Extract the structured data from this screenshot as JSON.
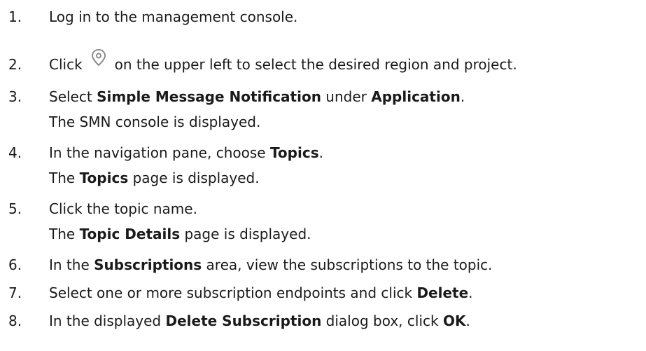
{
  "steps": [
    {
      "num": "1.",
      "parts": [
        "Log in to the management console."
      ]
    },
    {
      "num": "2.",
      "before": "Click",
      "after": "on the upper left to select the desired region and project."
    },
    {
      "num": "3.",
      "parts": [
        "Select ",
        "Simple Message Notification",
        " under ",
        "Application",
        "."
      ],
      "sub": "The SMN console is displayed."
    },
    {
      "num": "4.",
      "parts": [
        "In the navigation pane, choose ",
        "Topics",
        "."
      ],
      "sub_parts": [
        "The ",
        "Topics",
        " page is displayed."
      ]
    },
    {
      "num": "5.",
      "parts": [
        "Click the topic name."
      ],
      "sub_parts": [
        "The ",
        "Topic Details",
        " page is displayed."
      ]
    },
    {
      "num": "6.",
      "parts": [
        "In the ",
        "Subscriptions",
        " area, view the subscriptions to the topic."
      ]
    },
    {
      "num": "7.",
      "parts": [
        "Select one or more subscription endpoints and click ",
        "Delete",
        "."
      ]
    },
    {
      "num": "8.",
      "parts": [
        "In the displayed ",
        "Delete Subscription",
        " dialog box, click ",
        "OK",
        "."
      ]
    }
  ],
  "icons": {
    "region": "location-pin-icon"
  }
}
